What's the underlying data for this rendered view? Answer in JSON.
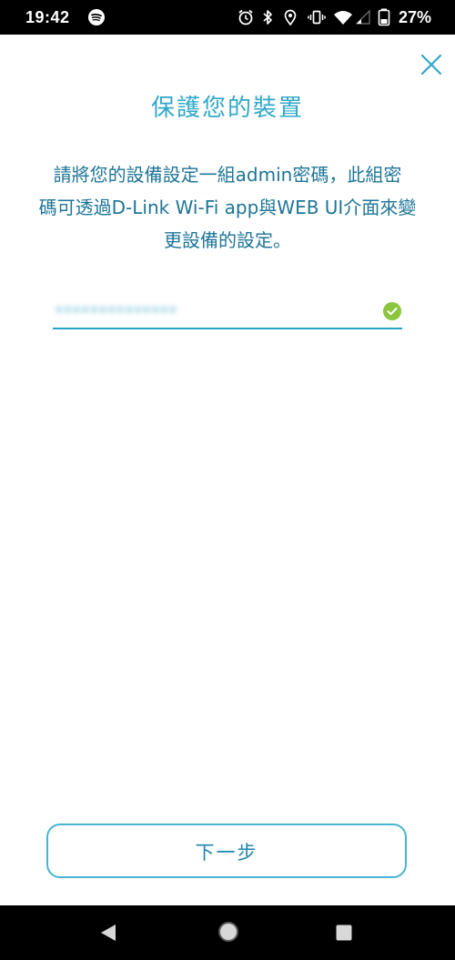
{
  "status_bar": {
    "time": "19:42",
    "battery_percent": "27%",
    "icons": [
      "spotify-icon",
      "alarm-icon",
      "bluetooth-icon",
      "location-icon",
      "vibrate-icon",
      "wifi-icon",
      "signal-icon",
      "battery-icon"
    ]
  },
  "page": {
    "title": "保護您的裝置",
    "description_line1": "請將您的設備設定一組admin密碼，此組密",
    "description_line2": "碼可透過D-Link Wi-Fi app與WEB UI介面來變",
    "description_line3": "更設備的設定。",
    "password_field": {
      "value": "a0f2983f052866",
      "valid": true
    },
    "next_button_label": "下一步",
    "close_icon": "close-icon"
  },
  "nav_bar": {
    "icons": [
      "back-icon",
      "home-icon",
      "recents-icon"
    ]
  },
  "colors": {
    "accent": "#2fa8c9",
    "text_dark_teal": "#1e7596",
    "success": "#8cc63f",
    "button_border": "#48b4d3"
  }
}
